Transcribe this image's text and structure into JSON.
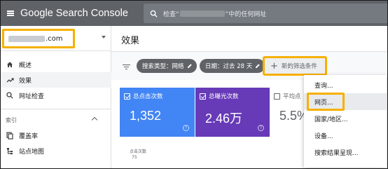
{
  "app": {
    "title": "Google Search Console"
  },
  "search": {
    "prefix": "检查“",
    "suffix": "”中的任何网址"
  },
  "property": {
    "suffix": ".com"
  },
  "sidebar": {
    "items": [
      {
        "label": "概述",
        "icon": "home-icon"
      },
      {
        "label": "效果",
        "icon": "trending-up-icon",
        "active": true
      },
      {
        "label": "网址检查",
        "icon": "search-icon"
      }
    ],
    "section": {
      "label": "索引"
    },
    "index_items": [
      {
        "label": "覆盖率",
        "icon": "file-copy-icon"
      },
      {
        "label": "站点地图",
        "icon": "sitemap-icon"
      }
    ]
  },
  "main": {
    "title": "效果",
    "filters": [
      {
        "label": "搜索类型：网络"
      },
      {
        "label": "日期：过去 28 天"
      }
    ],
    "new_filter": {
      "label": "新的筛选条件"
    },
    "cards": [
      {
        "label": "总点击次数",
        "value": "1,352",
        "color": "#4285f4",
        "checked": true
      },
      {
        "label": "总曝光次数",
        "value": "2.46万",
        "color": "#673ab7",
        "checked": true
      },
      {
        "label": "平均点",
        "value": "5.5%",
        "color": "#ffffff",
        "checked": false
      }
    ],
    "chart": {
      "label": "点击次数",
      "tick": "75"
    }
  },
  "dropdown": {
    "items": [
      {
        "label": "查询..."
      },
      {
        "label": "网页...",
        "selected": true
      },
      {
        "label": "国家/地区..."
      },
      {
        "label": "设备..."
      },
      {
        "label": "搜索结果呈现..."
      }
    ]
  },
  "colors": {
    "topbar": "#5f6368",
    "highlight": "#f6b000",
    "clicks": "#4285f4",
    "impressions": "#673ab7"
  }
}
